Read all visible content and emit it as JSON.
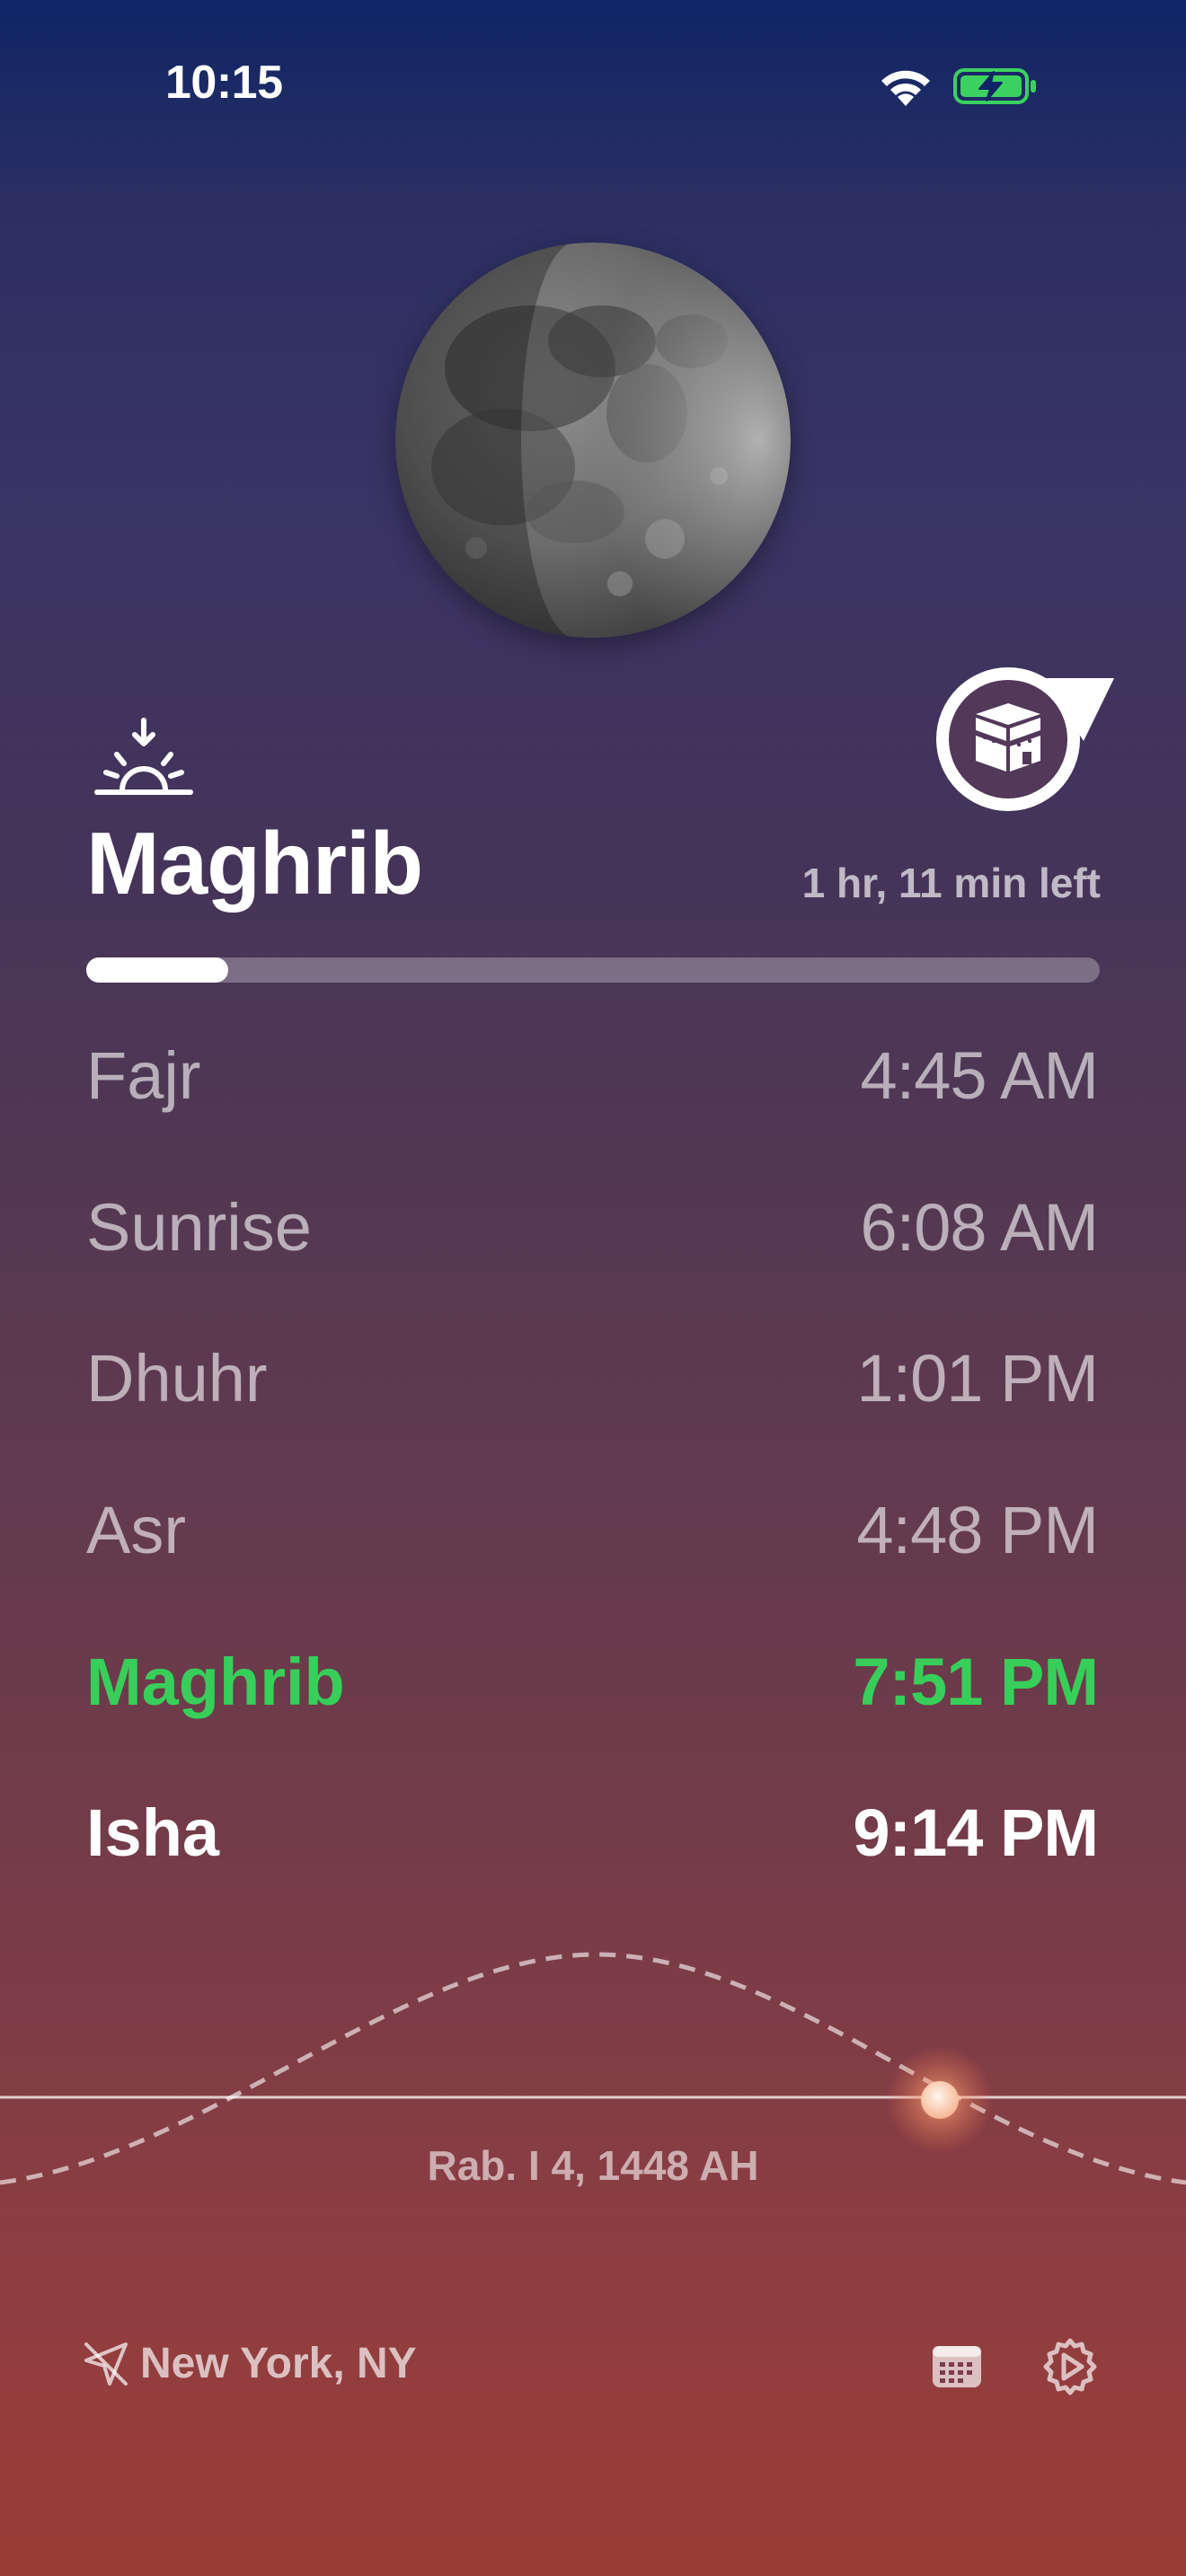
{
  "status_bar": {
    "time": "10:15",
    "wifi_icon": "wifi-icon",
    "battery_icon": "battery-charging-icon"
  },
  "header": {
    "moon_image": "moon-phase-image",
    "qibla_icon": "kaaba-icon"
  },
  "current": {
    "icon": "sunset-icon",
    "prayer": "Maghrib",
    "time_left": "1 hr, 11 min left",
    "progress_fraction": 0.14
  },
  "prayers": [
    {
      "name": "Fajr",
      "time": "4:45 AM",
      "state": "past"
    },
    {
      "name": "Sunrise",
      "time": "6:08 AM",
      "state": "past"
    },
    {
      "name": "Dhuhr",
      "time": "1:01 PM",
      "state": "past"
    },
    {
      "name": "Asr",
      "time": "4:48 PM",
      "state": "past"
    },
    {
      "name": "Maghrib",
      "time": "7:51 PM",
      "state": "active"
    },
    {
      "name": "Isha",
      "time": "9:14 PM",
      "state": "next"
    }
  ],
  "sun_path": {
    "hijri_date": "Rab. I 4, 1448 AH"
  },
  "footer": {
    "location": "New York, NY",
    "location_icon": "location-arrow-icon",
    "calendar_icon": "calendar-icon",
    "settings_icon": "gear-icon"
  },
  "colors": {
    "active": "#37cf5a",
    "gradient_top": "#0f2566",
    "gradient_bottom": "#9b3d36"
  }
}
